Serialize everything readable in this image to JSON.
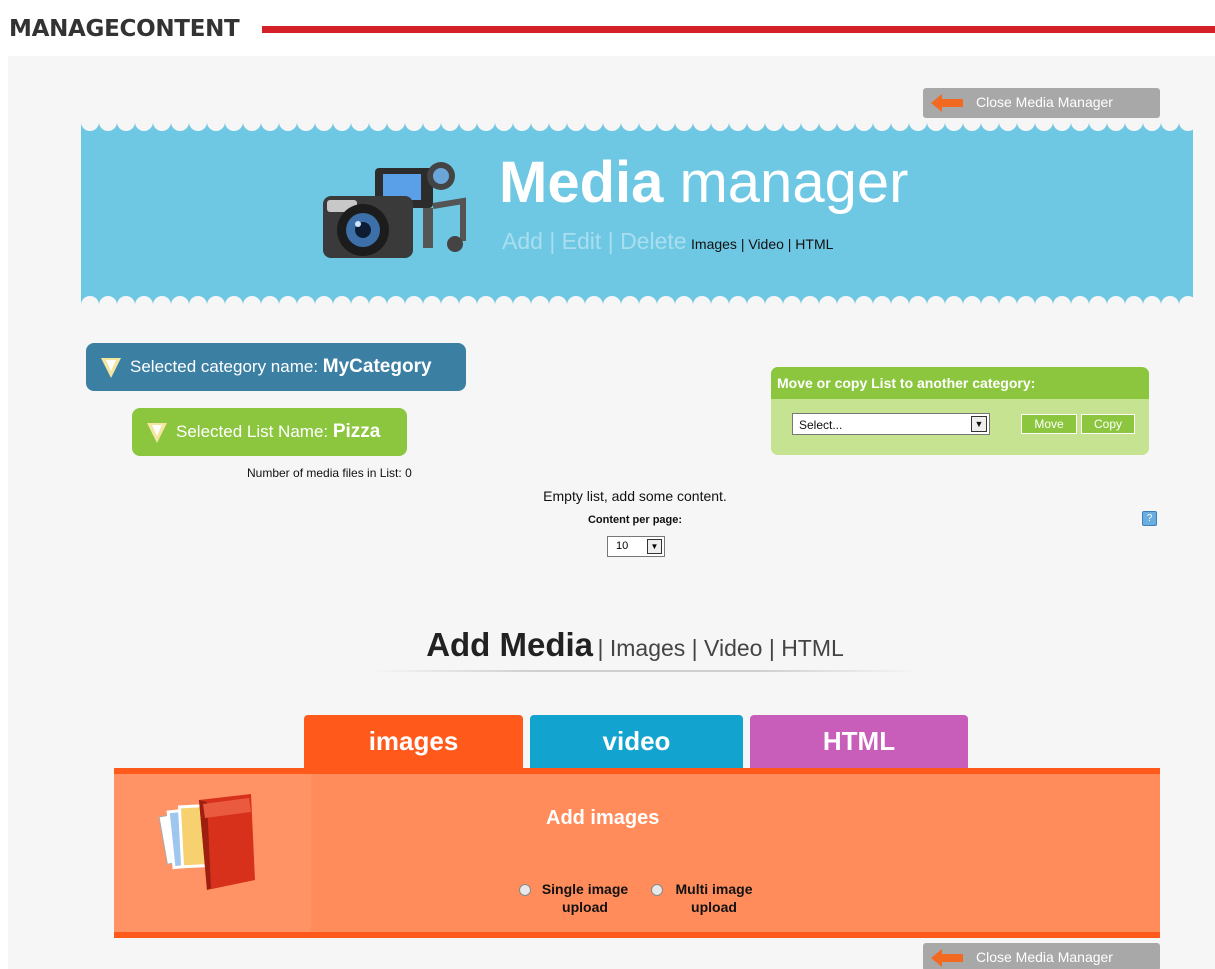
{
  "page": {
    "title": "MANAGECONTENT"
  },
  "close_button": {
    "label": "Close Media Manager"
  },
  "banner": {
    "title_bold": "Media",
    "title_rest": " manager",
    "ops": "Add | Edit | Delete",
    "types": "Images | Video | HTML"
  },
  "category": {
    "prefix": "Selected category name: ",
    "name": "MyCategory"
  },
  "list": {
    "prefix": "Selected List Name: ",
    "name": "Pizza"
  },
  "media_count": "Number of media files in List: 0",
  "move_copy": {
    "heading": "Move or copy List to another category:",
    "select_value": "Select...",
    "move_label": "Move",
    "copy_label": "Copy"
  },
  "empty_message": "Empty list, add some content.",
  "content_per_page": {
    "label": "Content per page:",
    "value": "10"
  },
  "add_media": {
    "title": "Add Media",
    "links": "| Images | Video | HTML"
  },
  "tabs": [
    {
      "label": "images",
      "color": "#ff5a1c"
    },
    {
      "label": "video",
      "color": "#13a3cf"
    },
    {
      "label": "HTML",
      "color": "#c95dba"
    }
  ],
  "upload": {
    "title": "Add images",
    "single_line1": "Single image",
    "single_line2": "upload",
    "multi_line1": "Multi image",
    "multi_line2": "upload"
  },
  "colors": {
    "accent_red": "#d42027",
    "banner_blue": "#6ec8e3",
    "category_blue": "#3b7fa3",
    "green": "#8cc63f",
    "orange": "#ff5a1c"
  }
}
